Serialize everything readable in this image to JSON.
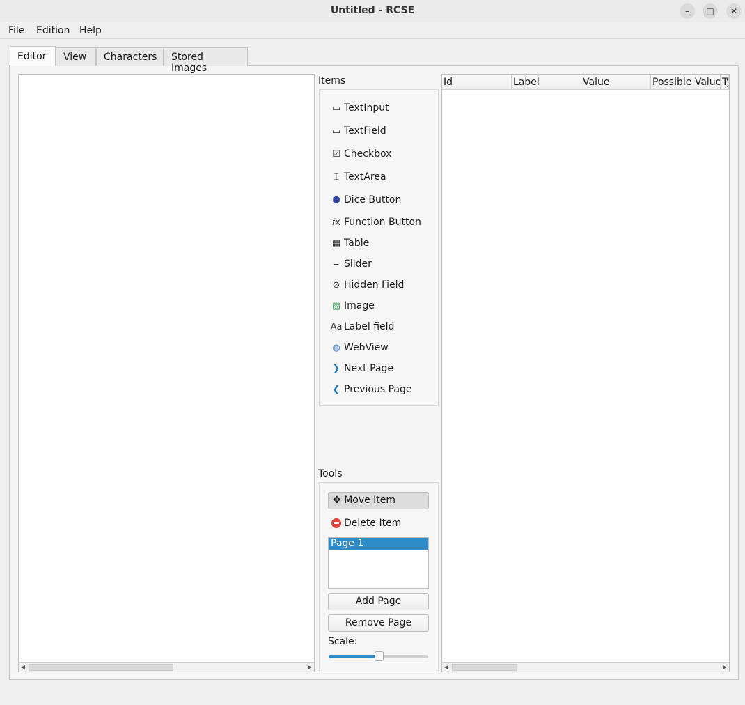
{
  "window": {
    "title": "Untitled - RCSE",
    "minimize": "–",
    "maximize": "□",
    "close": "✕"
  },
  "menu": [
    "File",
    "Edition",
    "Help"
  ],
  "tabs": [
    "Editor",
    "View",
    "Characters",
    "Stored Images"
  ],
  "items": {
    "title": "Items",
    "list": [
      {
        "label": "TextInput",
        "icon": "text-input-icon"
      },
      {
        "label": "TextField",
        "icon": "text-field-icon"
      },
      {
        "label": "Checkbox",
        "icon": "checkbox-icon"
      },
      {
        "label": "TextArea",
        "icon": "text-area-icon"
      },
      {
        "label": "Dice Button",
        "icon": "dice-icon"
      },
      {
        "label": "Function Button",
        "icon": "function-icon"
      },
      {
        "label": "Table",
        "icon": "table-icon"
      },
      {
        "label": "Slider",
        "icon": "slider-icon"
      },
      {
        "label": "Hidden Field",
        "icon": "hidden-eye-icon"
      },
      {
        "label": "Image",
        "icon": "image-icon"
      },
      {
        "label": "Label field",
        "icon": "font-icon"
      },
      {
        "label": "WebView",
        "icon": "globe-icon"
      },
      {
        "label": "Next Page",
        "icon": "arrow-right-icon"
      },
      {
        "label": "Previous Page",
        "icon": "arrow-left-icon"
      }
    ]
  },
  "tools": {
    "title": "Tools",
    "move": "Move Item",
    "delete": "Delete Item",
    "pages": [
      "Page 1"
    ],
    "add_page": "Add Page",
    "remove_page": "Remove Page",
    "scale_label": "Scale:",
    "scale_percent": 50
  },
  "table": {
    "columns": [
      "Id",
      "Label",
      "Value",
      "Possible Value",
      "Ty"
    ]
  },
  "colors": {
    "selection": "#308cc6"
  }
}
